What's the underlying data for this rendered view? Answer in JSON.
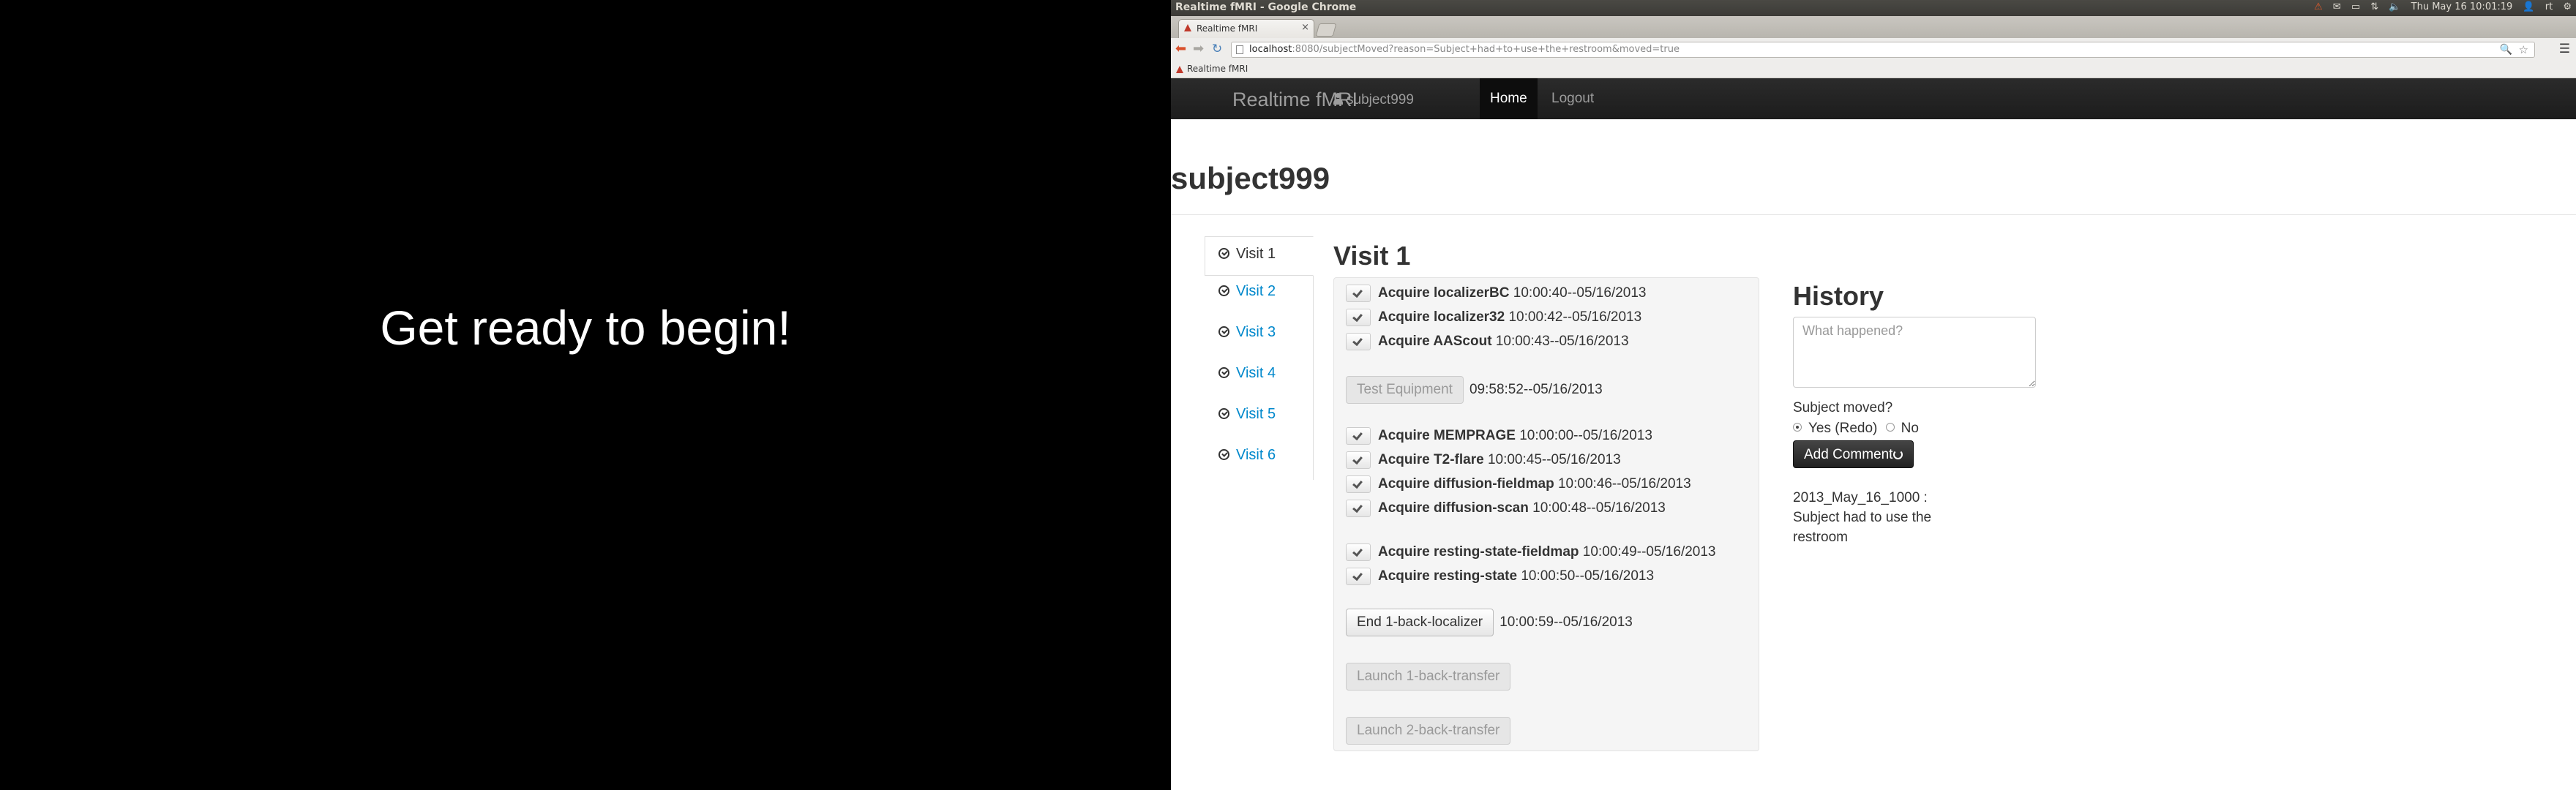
{
  "left_display": {
    "message": "Get ready to begin!"
  },
  "os": {
    "window_title": "Realtime fMRI - Google Chrome",
    "datetime": "Thu May 16 10:01:19",
    "user": "rt"
  },
  "browser": {
    "tab_title": "Realtime fMRI",
    "url_host": "localhost",
    "url_rest": ":8080/subjectMoved?reason=Subject+had+to+use+the+restroom&moved=true",
    "bookmark": "Realtime fMRI"
  },
  "navbar": {
    "brand": "Realtime fMRI",
    "user": "subject999",
    "home": "Home",
    "logout": "Logout"
  },
  "page": {
    "title": "subject999"
  },
  "visits": [
    {
      "label": "Visit 1",
      "active": true
    },
    {
      "label": "Visit 2",
      "active": false
    },
    {
      "label": "Visit 3",
      "active": false
    },
    {
      "label": "Visit 4",
      "active": false
    },
    {
      "label": "Visit 5",
      "active": false
    },
    {
      "label": "Visit 6",
      "active": false
    }
  ],
  "visit_heading": "Visit 1",
  "tasks": {
    "group1": [
      {
        "name": "Acquire localizerBC",
        "time": "10:00:40--05/16/2013"
      },
      {
        "name": "Acquire localizer32",
        "time": "10:00:42--05/16/2013"
      },
      {
        "name": "Acquire AAScout",
        "time": "10:00:43--05/16/2013"
      }
    ],
    "test_equipment": {
      "label": "Test Equipment",
      "time": "09:58:52--05/16/2013"
    },
    "group2": [
      {
        "name": "Acquire MEMPRAGE",
        "time": "10:00:00--05/16/2013"
      },
      {
        "name": "Acquire T2-flare",
        "time": "10:00:45--05/16/2013"
      },
      {
        "name": "Acquire diffusion-fieldmap",
        "time": "10:00:46--05/16/2013"
      },
      {
        "name": "Acquire diffusion-scan",
        "time": "10:00:48--05/16/2013"
      }
    ],
    "group3": [
      {
        "name": "Acquire resting-state-fieldmap",
        "time": "10:00:49--05/16/2013"
      },
      {
        "name": "Acquire resting-state",
        "time": "10:00:50--05/16/2013"
      }
    ],
    "end_localizer": {
      "label": "End 1-back-localizer",
      "time": "10:00:59--05/16/2013"
    },
    "launch_transfer1": {
      "label": "Launch 1-back-transfer"
    },
    "launch_transfer2": {
      "label": "Launch 2-back-transfer"
    }
  },
  "history": {
    "heading": "History",
    "placeholder": "What happened?",
    "moved_question": "Subject moved?",
    "yes_label": "Yes (Redo)",
    "no_label": "No",
    "yes_checked": true,
    "add_comment": "Add Comment",
    "entries": [
      "2013_May_16_1000 : Subject had to use the restroom"
    ]
  }
}
